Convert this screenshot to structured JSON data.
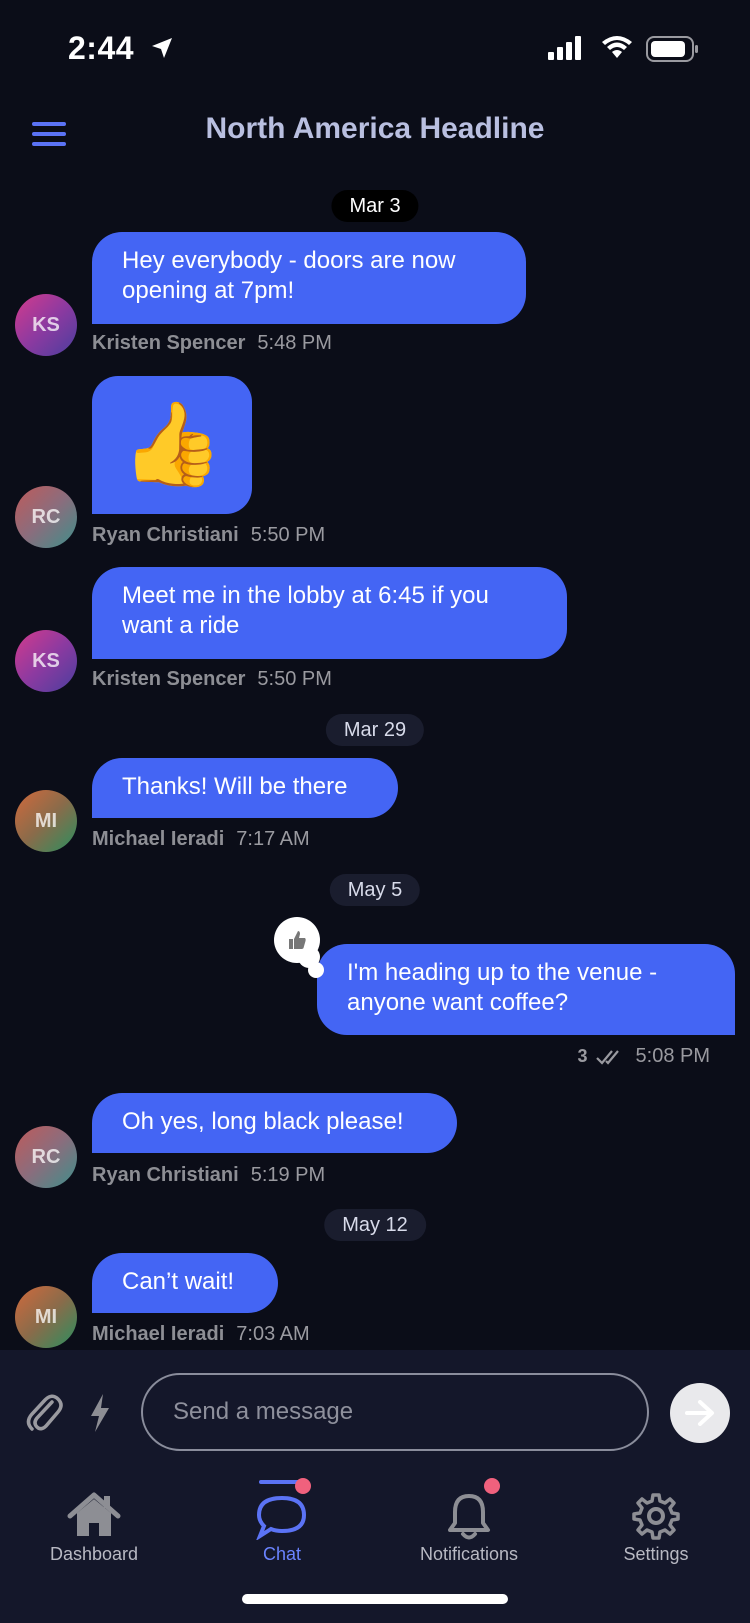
{
  "status_bar": {
    "time": "2:44",
    "icons": [
      "location-arrow-icon",
      "signal-icon",
      "wifi-icon",
      "battery-icon"
    ]
  },
  "header": {
    "title": "North America Headline",
    "menu_icon": "hamburger-menu-icon"
  },
  "colors": {
    "background": "#0b0d18",
    "bubble": "#4465f4",
    "accent": "#5b73f5",
    "badge": "#f0617d"
  },
  "dates": [
    "Mar 3",
    "Mar 29",
    "May 5",
    "May 12"
  ],
  "messages": [
    {
      "initials": "KS",
      "text": "Hey everybody - doors are now opening at 7pm!",
      "sender": "Kristen Spencer",
      "time": "5:48 PM"
    },
    {
      "initials": "RC",
      "emoji": "👍",
      "sender": "Ryan Christiani",
      "time": "5:50 PM"
    },
    {
      "initials": "KS",
      "text": "Meet me in the lobby at 6:45 if you want a ride",
      "sender": "Kristen Spencer",
      "time": "5:50 PM"
    },
    {
      "initials": "MI",
      "text": "Thanks! Will be there",
      "sender": "Michael Ieradi",
      "time": "7:17 AM"
    },
    {
      "outgoing": true,
      "text": "I'm heading up to the venue  - anyone want coffee?",
      "read_count": "3",
      "time": "5:08 PM",
      "reaction": "thumbs-up-icon"
    },
    {
      "initials": "RC",
      "text": "Oh yes, long black please!",
      "sender": "Ryan Christiani",
      "time": "5:19 PM"
    },
    {
      "initials": "MI",
      "text": "Can’t wait!",
      "sender": "Michael Ieradi",
      "time": "7:03 AM"
    }
  ],
  "composer": {
    "placeholder": "Send a message",
    "attach_icon": "paperclip-icon",
    "quick_icon": "lightning-bolt-icon",
    "send_icon": "arrow-right-icon"
  },
  "tabs": [
    {
      "label": "Dashboard",
      "icon": "home-icon",
      "active": false,
      "badge": false
    },
    {
      "label": "Chat",
      "icon": "chat-bubble-icon",
      "active": true,
      "badge": true
    },
    {
      "label": "Notifications",
      "icon": "bell-icon",
      "active": false,
      "badge": true
    },
    {
      "label": "Settings",
      "icon": "gear-icon",
      "active": false,
      "badge": false
    }
  ]
}
